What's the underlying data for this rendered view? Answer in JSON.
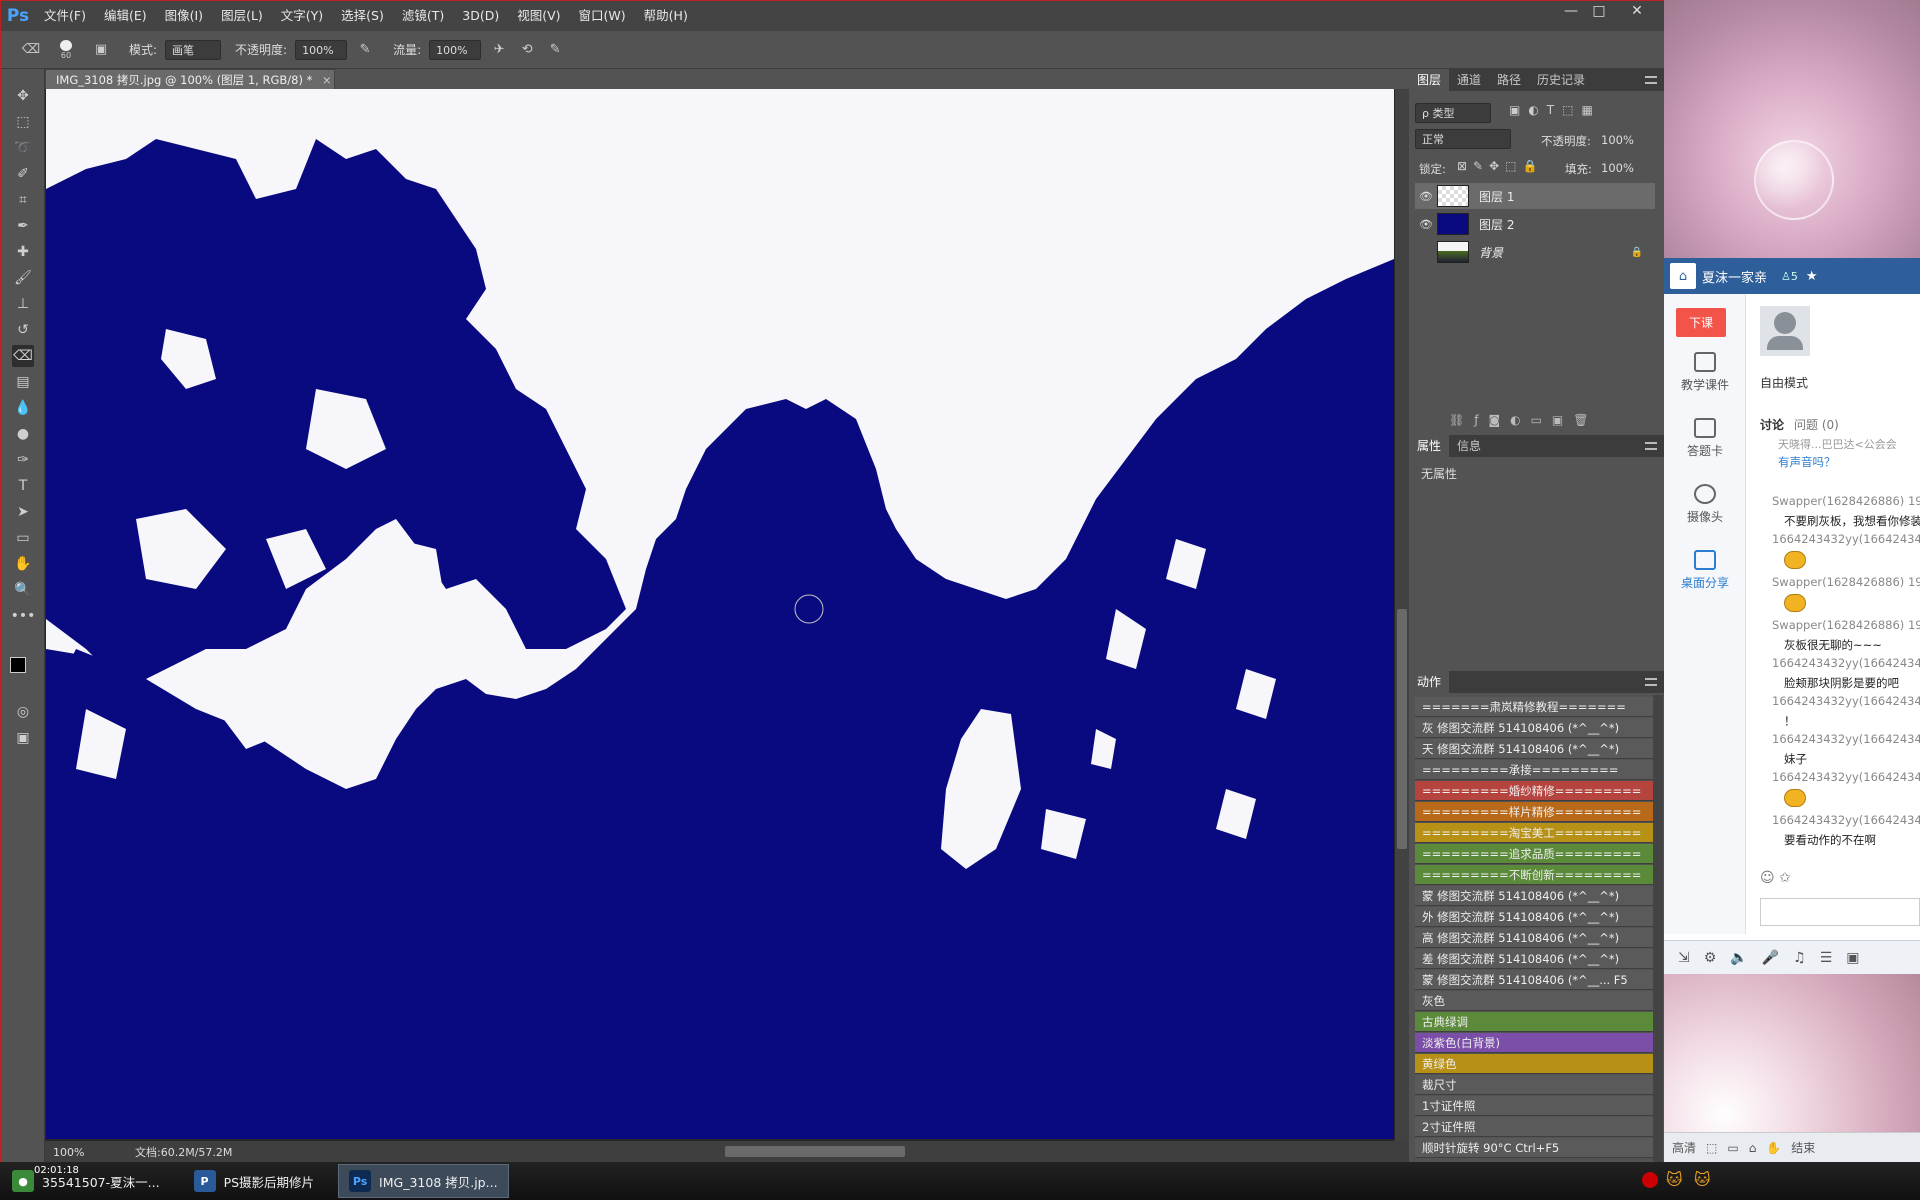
{
  "app": {
    "logo": "Ps",
    "menu": [
      "文件(F)",
      "编辑(E)",
      "图像(I)",
      "图层(L)",
      "文字(Y)",
      "选择(S)",
      "滤镜(T)",
      "3D(D)",
      "视图(V)",
      "窗口(W)",
      "帮助(H)"
    ],
    "window_controls": [
      "—",
      "□",
      "✕"
    ]
  },
  "options": {
    "brush_size": "60",
    "mode_label": "模式:",
    "mode_value": "画笔",
    "opacity_label": "不透明度:",
    "opacity_value": "100%",
    "flow_label": "流量:",
    "flow_value": "100%"
  },
  "document": {
    "tab_title": "IMG_3108 拷贝.jpg @ 100% (图层 1, RGB/8) *",
    "tab_close": "×",
    "zoom": "100%",
    "doc_info": "文档:60.2M/57.2M",
    "fg_color": "#0a0a80",
    "canvas_bg": "#f7f7fb"
  },
  "layers_panel": {
    "tabs": [
      "图层",
      "通道",
      "路径",
      "历史记录"
    ],
    "filter_label": "ρ 类型",
    "blend_mode": "正常",
    "opacity_label": "不透明度:",
    "opacity_value": "100%",
    "lock_label": "锁定:",
    "fill_label": "填充:",
    "fill_value": "100%",
    "layers": [
      {
        "name": "图层 1",
        "visible": true
      },
      {
        "name": "图层 2",
        "visible": true
      },
      {
        "name": "背景",
        "visible": false
      }
    ]
  },
  "properties_panel": {
    "tabs": [
      "属性",
      "信息"
    ],
    "empty_text": "无属性"
  },
  "actions_panel": {
    "tab": "动作",
    "items": [
      {
        "label": "=======肃岚精修教程=======",
        "color": "#5a5a5a"
      },
      {
        "label": "灰 修图交流群 514108406 (*^__^*)",
        "color": "#5a5a5a"
      },
      {
        "label": "天 修图交流群 514108406 (*^__^*)",
        "color": "#5a5a5a"
      },
      {
        "label": "=========承接=========",
        "color": "#5a5a5a"
      },
      {
        "label": "=========婚纱精修=========",
        "color": "#b5443f"
      },
      {
        "label": "=========样片精修=========",
        "color": "#b86a1a"
      },
      {
        "label": "=========淘宝美工=========",
        "color": "#b79016"
      },
      {
        "label": "=========追求品质=========",
        "color": "#5b8a3a"
      },
      {
        "label": "=========不断创新=========",
        "color": "#5b8a3a"
      },
      {
        "label": "蒙 修图交流群 514108406 (*^__^*)",
        "color": "#5a5a5a"
      },
      {
        "label": "外 修图交流群 514108406 (*^__^*)",
        "color": "#5a5a5a"
      },
      {
        "label": "高 修图交流群 514108406 (*^__^*)",
        "color": "#5a5a5a"
      },
      {
        "label": "差 修图交流群 514108406 (*^__^*)",
        "color": "#5a5a5a"
      },
      {
        "label": "蒙 修图交流群 514108406 (*^__...  F5",
        "color": "#5a5a5a"
      },
      {
        "label": "灰色",
        "color": "#5a5a5a"
      },
      {
        "label": "古典绿调",
        "color": "#5b8a3a"
      },
      {
        "label": "淡紫色(白背景)",
        "color": "#7b4fa8"
      },
      {
        "label": "黄绿色",
        "color": "#b79016"
      },
      {
        "label": "裁尺寸",
        "color": "#5a5a5a"
      },
      {
        "label": "1寸证件照",
        "color": "#5a5a5a"
      },
      {
        "label": "2寸证件照",
        "color": "#5a5a5a"
      },
      {
        "label": "顺时针旋转 90°C        Ctrl+F5",
        "color": "#5a5a5a"
      }
    ]
  },
  "chat": {
    "group_name": "夏沫一家亲",
    "member_count": "5",
    "side_buttons": [
      "下课",
      "教学课件",
      "答题卡",
      "摄像头",
      "桌面分享"
    ],
    "mode": "自由模式",
    "tabs": [
      "讨论",
      "问题 (0)"
    ],
    "notice": "天晓得...巴巴达<公会会",
    "notice_link": "有声音吗？",
    "messages": [
      {
        "user": "Swapper(1628426886) 19:",
        "text": "不要刷灰板，我想看你修装"
      },
      {
        "user": "1664243432yy(166424343",
        "text": ""
      },
      {
        "user": "Swapper(1628426886) 19:",
        "text": ""
      },
      {
        "user": "Swapper(1628426886) 19:",
        "text": "灰板很无聊的~~~"
      },
      {
        "user": "1664243432yy(166424343",
        "text": "脸颊那块阴影是要的吧"
      },
      {
        "user": "1664243432yy(166424343",
        "text": "！"
      },
      {
        "user": "1664243432yy(166424343",
        "text": "妹子"
      },
      {
        "user": "1664243432yy(166424343",
        "text": ""
      },
      {
        "user": "1664243432yy(166424343",
        "text": "要看动作的不在啊"
      }
    ],
    "status": [
      "高清",
      "结束"
    ]
  },
  "taskbar": {
    "clock": "02:01:18",
    "tasks": [
      {
        "label": "35541507-夏沫一...",
        "icon_color": "#3a8a3a"
      },
      {
        "label": "PS摄影后期修片",
        "icon_color": "#2a5a9a"
      },
      {
        "label": "IMG_3108 拷贝.jp...",
        "icon_color": "#1a3a6a"
      }
    ]
  }
}
